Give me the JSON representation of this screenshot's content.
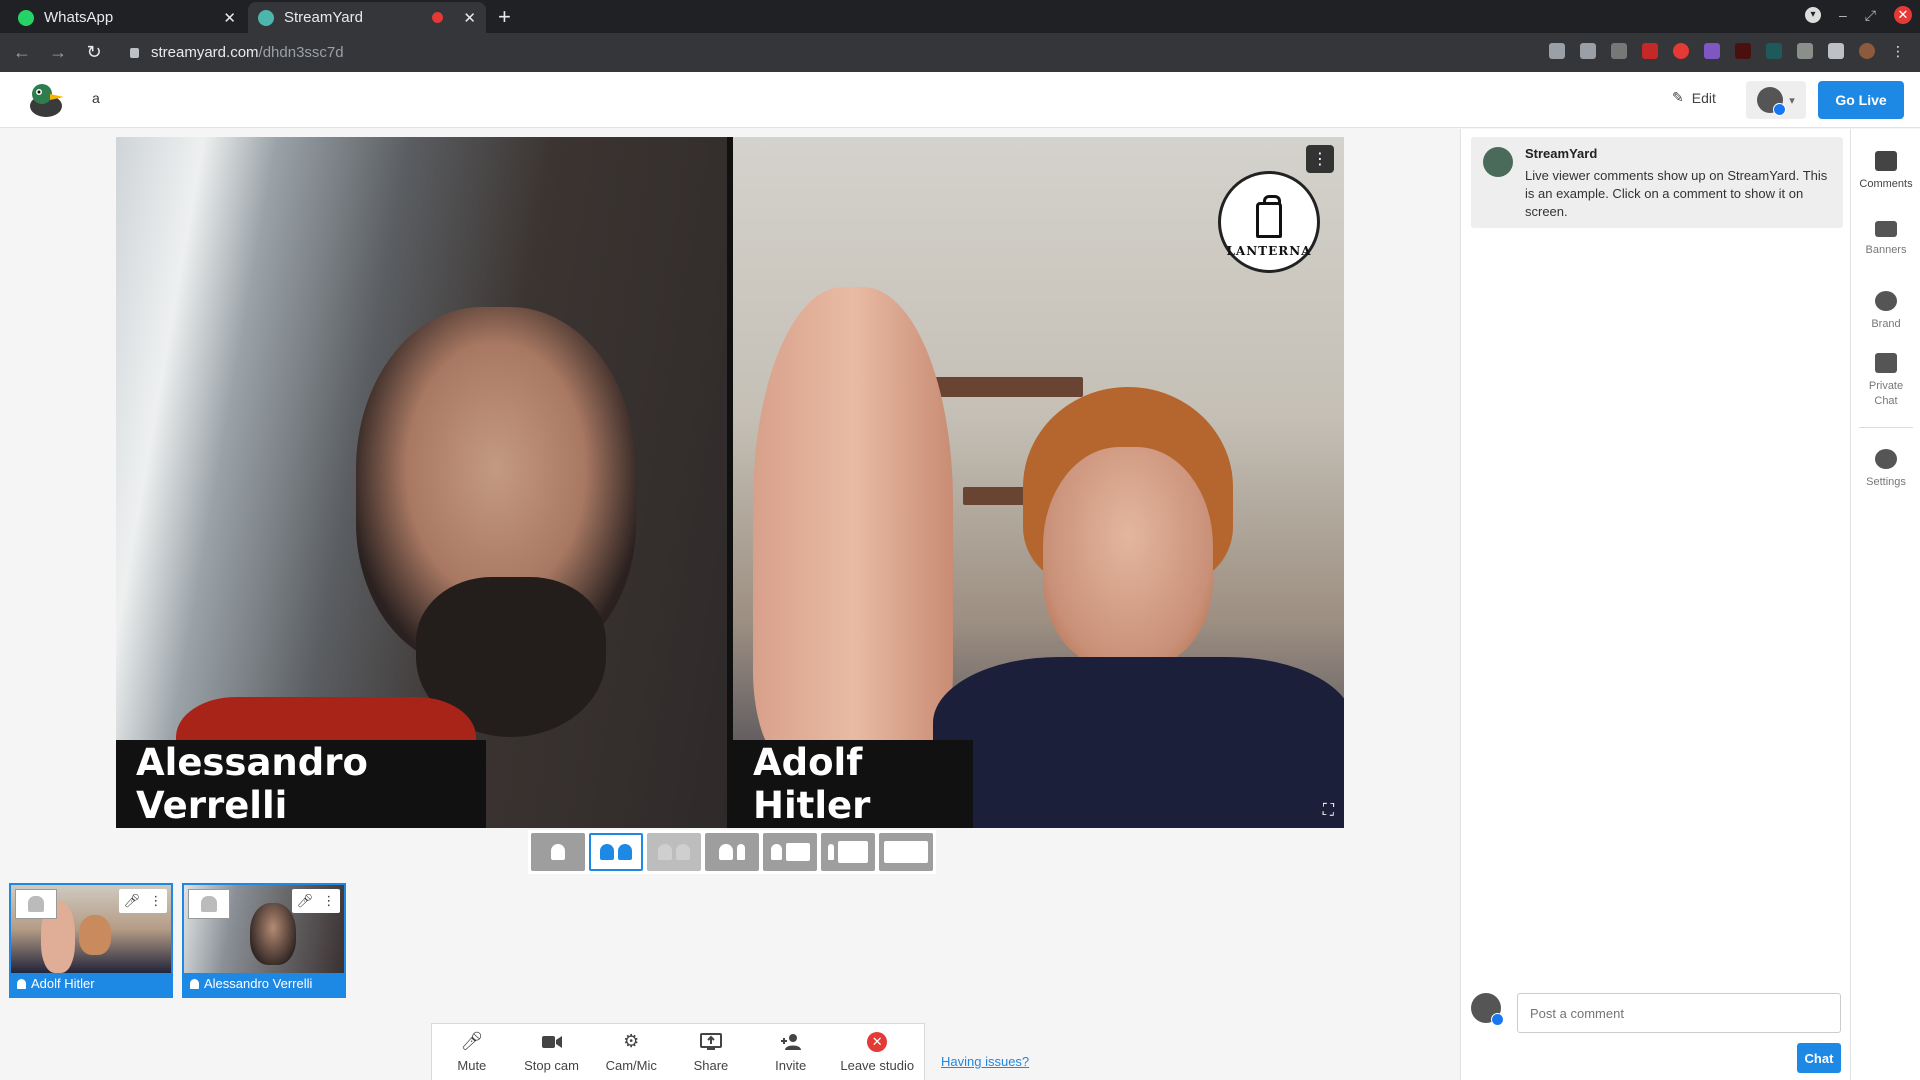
{
  "browser": {
    "tabs": [
      {
        "title": "WhatsApp",
        "active": false
      },
      {
        "title": "StreamYard",
        "active": true
      }
    ],
    "url_host": "streamyard.com",
    "url_path": "/dhdn3ssc7d"
  },
  "header": {
    "studio_title": "a",
    "edit_label": "Edit",
    "go_live_label": "Go Live"
  },
  "stage": {
    "participants": [
      {
        "name": "Alessandro Verrelli"
      },
      {
        "name": "Adolf Hitler"
      }
    ],
    "logo_text": "LANTERNA"
  },
  "thumbnails": [
    {
      "name": "Adolf Hitler"
    },
    {
      "name": "Alessandro Verrelli"
    }
  ],
  "toolbar": {
    "mute": "Mute",
    "stop_cam": "Stop cam",
    "cam_mic": "Cam/Mic",
    "share": "Share",
    "invite": "Invite",
    "leave": "Leave studio",
    "issues": "Having issues?"
  },
  "comments": {
    "items": [
      {
        "author": "StreamYard",
        "text": "Live viewer comments show up on StreamYard. This is an example. Click on a comment to show it on screen."
      }
    ],
    "input_placeholder": "Post a comment",
    "chat_button": "Chat"
  },
  "rail": {
    "comments": "Comments",
    "banners": "Banners",
    "brand": "Brand",
    "private_chat_1": "Private",
    "private_chat_2": "Chat",
    "settings": "Settings"
  },
  "colors": {
    "accent": "#1e88e5",
    "danger": "#e53935"
  }
}
